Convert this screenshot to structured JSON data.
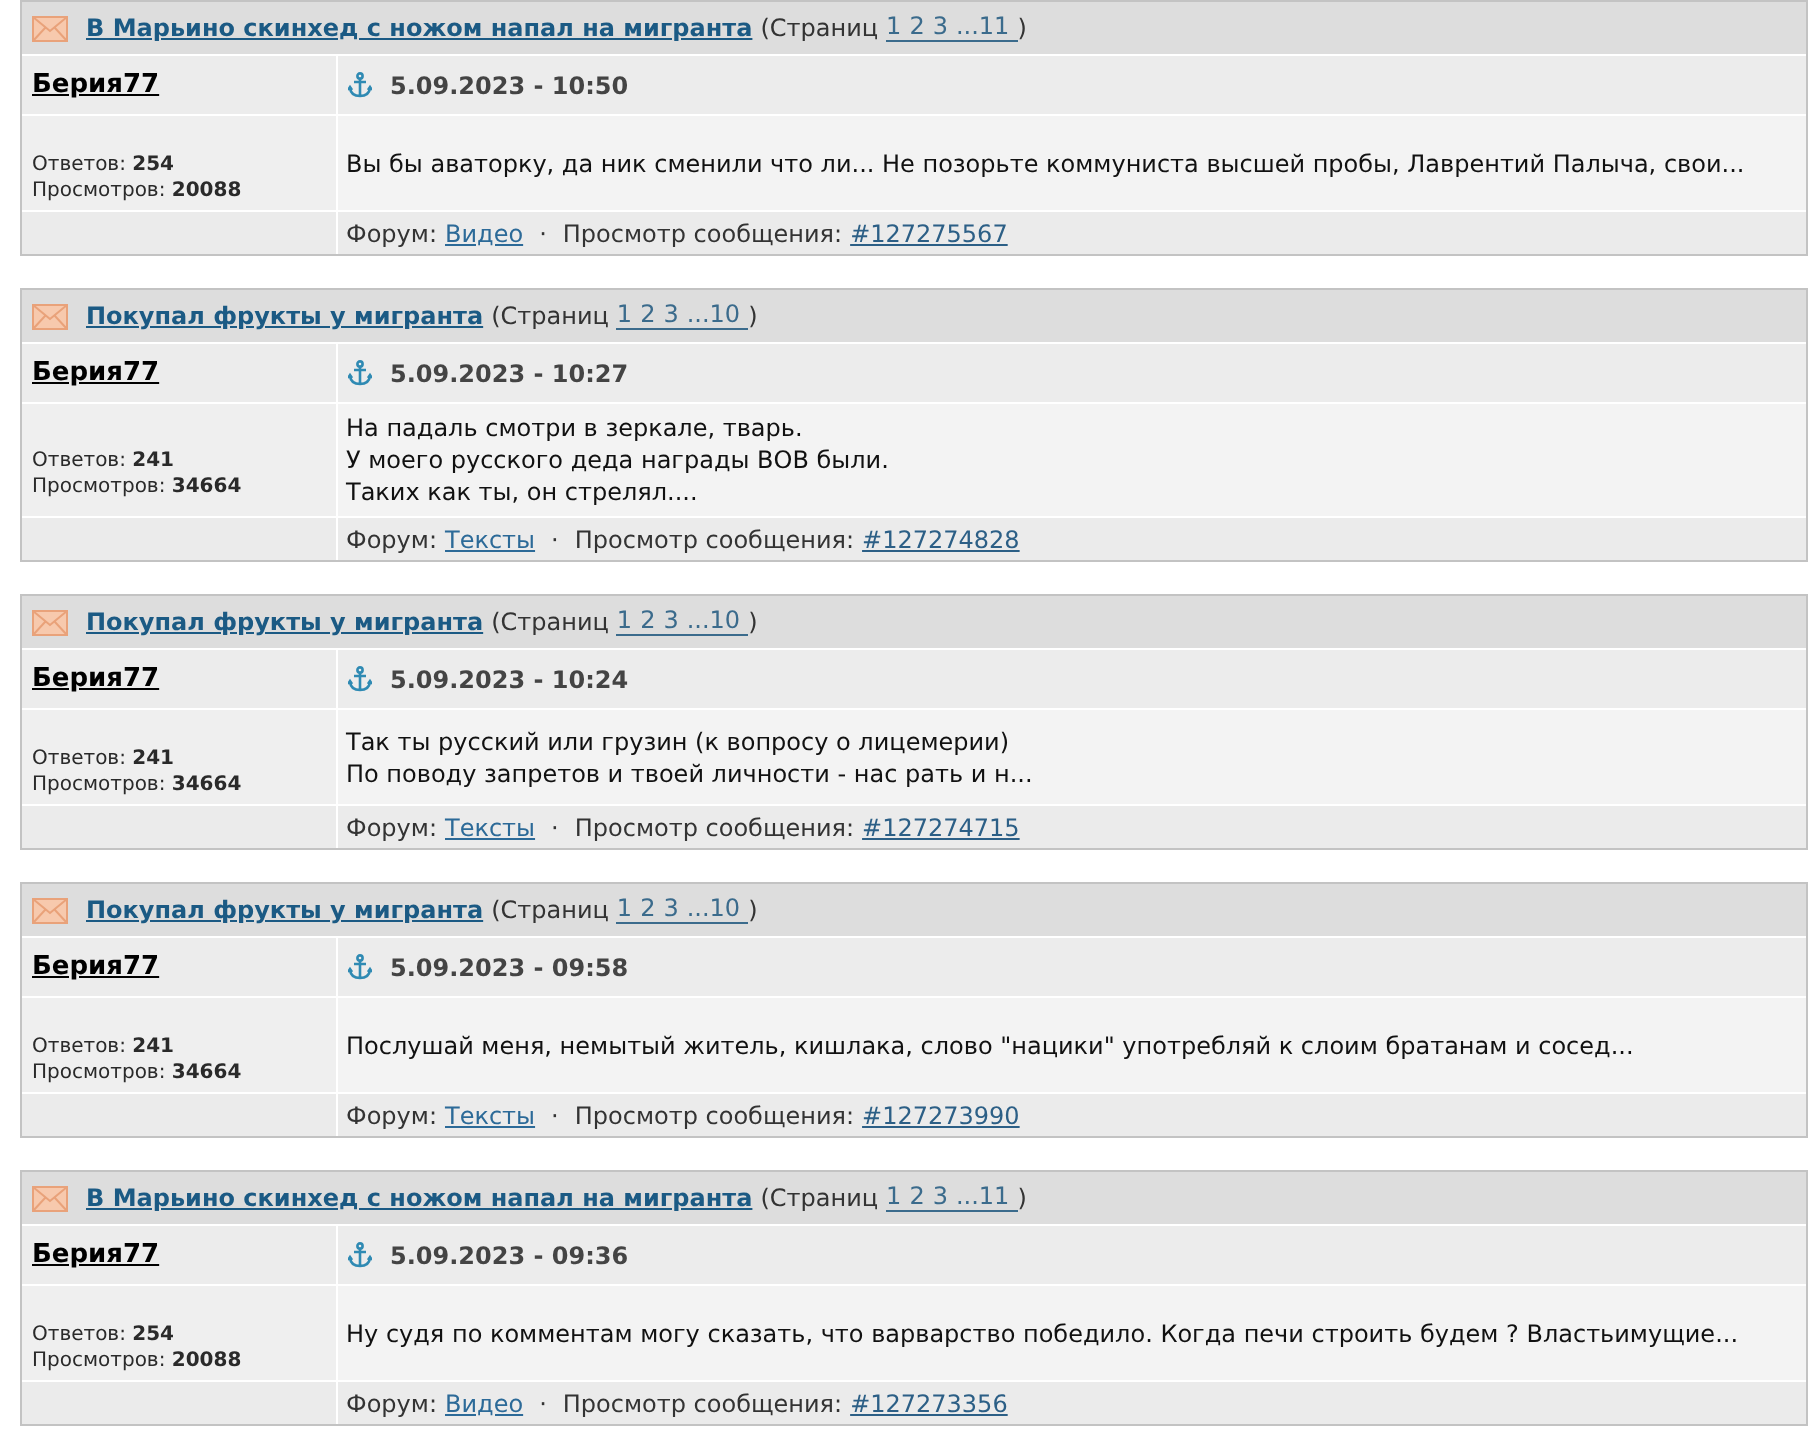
{
  "posts": [
    {
      "topic": {
        "title": "В Марьино скинхед с ножом напал на мигранта",
        "pages_label": "(Страниц",
        "pages": [
          "1",
          "2",
          "3",
          "...11"
        ],
        "pages_close": ")"
      },
      "author": "Берия77",
      "timestamp": "5.09.2023 - 10:50",
      "stats": [
        "Ответов: **254**",
        "Просмотров: **20088**"
      ],
      "body": [
        "Вы бы аваторку, да ник сменили что ли... Не позорьте коммуниста высшей пробы, Лаврентий Палыча, свои..."
      ],
      "forum_label": "Форум:",
      "forum": "Видео",
      "separator": "·",
      "view_label": "Просмотр сообщения:",
      "post_link": "#127275567"
    },
    {
      "topic": {
        "title": "Покупал фрукты у мигранта",
        "pages_label": "(Страниц",
        "pages": [
          "1",
          "2",
          "3",
          "...10"
        ],
        "pages_close": ")"
      },
      "author": "Берия77",
      "timestamp": "5.09.2023 - 10:27",
      "stats": [
        "Ответов: **241**",
        "Просмотров: **34664**"
      ],
      "body": [
        "На падаль смотри в зеркале, тварь.",
        "У моего русского деда награды ВОВ были.",
        "Таких как ты, он стрелял...."
      ],
      "forum_label": "Форум:",
      "forum": "Тексты",
      "separator": "·",
      "view_label": "Просмотр сообщения:",
      "post_link": "#127274828"
    },
    {
      "topic": {
        "title": "Покупал фрукты у мигранта",
        "pages_label": "(Страниц",
        "pages": [
          "1",
          "2",
          "3",
          "...10"
        ],
        "pages_close": ")"
      },
      "author": "Берия77",
      "timestamp": "5.09.2023 - 10:24",
      "stats": [
        "Ответов: **241**",
        "Просмотров: **34664**"
      ],
      "body": [
        "Так ты русский или грузин (к вопросу о лицемерии)",
        "По поводу запретов и твоей личности - нас рать и н..."
      ],
      "forum_label": "Форум:",
      "forum": "Тексты",
      "separator": "·",
      "view_label": "Просмотр сообщения:",
      "post_link": "#127274715"
    },
    {
      "topic": {
        "title": "Покупал фрукты у мигранта",
        "pages_label": "(Страниц",
        "pages": [
          "1",
          "2",
          "3",
          "...10"
        ],
        "pages_close": ")"
      },
      "author": "Берия77",
      "timestamp": "5.09.2023 - 09:58",
      "stats": [
        "Ответов: **241**",
        "Просмотров: **34664**"
      ],
      "body": [
        "Послушай меня, немытый житель, кишлака, слово \"нацики\" употребляй к слоим братанам и сосед..."
      ],
      "forum_label": "Форум:",
      "forum": "Тексты",
      "separator": "·",
      "view_label": "Просмотр сообщения:",
      "post_link": "#127273990"
    },
    {
      "topic": {
        "title": "В Марьино скинхед с ножом напал на мигранта",
        "pages_label": "(Страниц",
        "pages": [
          "1",
          "2",
          "3",
          "...11"
        ],
        "pages_close": ")"
      },
      "author": "Берия77",
      "timestamp": "5.09.2023 - 09:36",
      "stats": [
        "Ответов: **254**",
        "Просмотров: **20088**"
      ],
      "body": [
        "Ну судя по комментам могу сказать, что варварство победило. Когда печи строить будем ? Властьимущие..."
      ],
      "forum_label": "Форум:",
      "forum": "Видео",
      "separator": "·",
      "view_label": "Просмотр сообщения:",
      "post_link": "#127273356"
    }
  ]
}
